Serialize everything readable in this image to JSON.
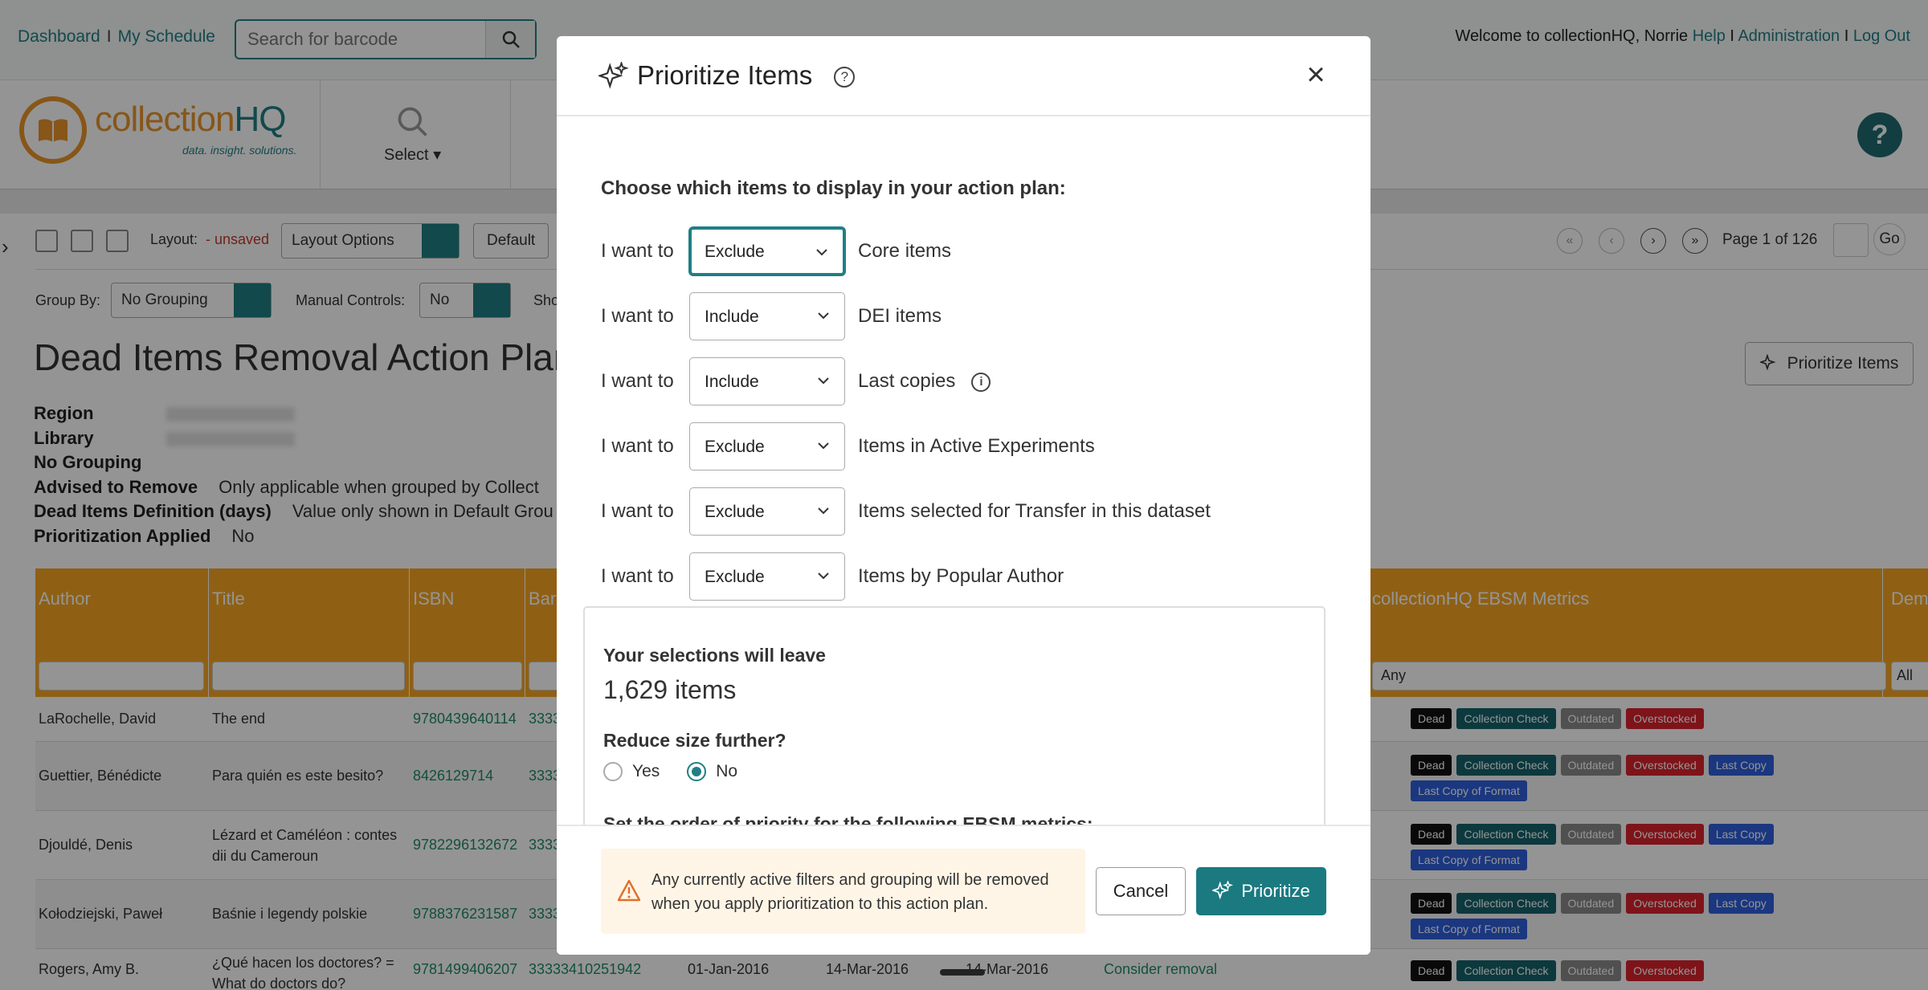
{
  "topnav": {
    "links": [
      "Dashboard",
      "My Schedule"
    ],
    "search_placeholder": "Search for barcode",
    "welcome": "Welcome to collectionHQ, Norrie",
    "right_links": [
      "Help",
      "Administration",
      "Log Out"
    ]
  },
  "brand": {
    "name_part1": "collection",
    "name_part2": "HQ",
    "tagline": "data. insight. solutions.",
    "select_label": "Select"
  },
  "toolbar": {
    "layout_label": "Layout:",
    "layout_state": "- unsaved",
    "layout_options": "Layout Options",
    "default_btn": "Default",
    "group_by_label": "Group By:",
    "group_by_value": "No Grouping",
    "manual_controls_label": "Manual Controls:",
    "manual_controls_value": "No",
    "show_label": "Sho",
    "page_text": "Page 1 of 126",
    "go": "Go"
  },
  "page": {
    "title": "Dead Items Removal Action Plan",
    "meta": [
      {
        "k": "Region",
        "v": ""
      },
      {
        "k": "Library",
        "v": ""
      },
      {
        "k": "No Grouping",
        "v": ""
      },
      {
        "k": "Advised to Remove",
        "v": "Only applicable when grouped by Collect"
      },
      {
        "k": "Dead Items Definition (days)",
        "v": "Value only shown in Default Grou"
      },
      {
        "k": "Prioritization Applied",
        "v": "No"
      }
    ],
    "prioritize_btn": "Prioritize Items"
  },
  "table": {
    "headers": [
      "Author",
      "Title",
      "ISBN",
      "Bar",
      "collectionHQ EBSM Metrics",
      "Dem"
    ],
    "ebsm_filter": "Any",
    "dem_filter": "All",
    "rows": [
      {
        "author": "LaRochelle, David",
        "title": "The end",
        "isbn": "9780439640114",
        "bar": "3333",
        "tags": [
          "Dead",
          "Collection Check",
          "Outdated",
          "Overstocked"
        ]
      },
      {
        "author": "Guettier, Bénédicte",
        "title": "Para quién es este besito?",
        "isbn": "8426129714",
        "bar": "3333",
        "tags": [
          "Dead",
          "Collection Check",
          "Outdated",
          "Overstocked",
          "Last Copy",
          "Last Copy of Format"
        ]
      },
      {
        "author": "Djouldé, Denis",
        "title": "Lézard et Caméléon : contes dii du Cameroun",
        "isbn": "9782296132672",
        "bar": "3333",
        "tags": [
          "Dead",
          "Collection Check",
          "Outdated",
          "Overstocked",
          "Last Copy",
          "Last Copy of Format"
        ]
      },
      {
        "author": "Kołodziejski, Paweł",
        "title": "Baśnie i legendy polskie",
        "isbn": "9788376231587",
        "bar": "3333",
        "tags": [
          "Dead",
          "Collection Check",
          "Outdated",
          "Overstocked",
          "Last Copy",
          "Last Copy of Format"
        ]
      },
      {
        "author": "Rogers, Amy B.",
        "title": "¿Qué hacen los doctores? = What do doctors do?",
        "isbn": "9781499406207",
        "bar": "33333410251942",
        "d1": "01-Jan-2016",
        "d2": "14-Mar-2016",
        "d3": "14-Mar-2016",
        "action": "Consider removal",
        "tags": [
          "Dead",
          "Collection Check",
          "Outdated",
          "Overstocked"
        ]
      }
    ]
  },
  "modal": {
    "title": "Prioritize Items",
    "instruction": "Choose which items to display in your action plan:",
    "i_want_to": "I want to",
    "options": [
      {
        "value": "Exclude",
        "label": "Core items"
      },
      {
        "value": "Include",
        "label": "DEI items"
      },
      {
        "value": "Include",
        "label": "Last copies"
      },
      {
        "value": "Exclude",
        "label": "Items in Active Experiments"
      },
      {
        "value": "Exclude",
        "label": "Items selected for Transfer in this dataset"
      },
      {
        "value": "Exclude",
        "label": "Items by Popular Author"
      }
    ],
    "summary_label": "Your selections will leave",
    "summary_value": "1,629 items",
    "reduce_label": "Reduce size further?",
    "yes": "Yes",
    "no": "No",
    "reduce_selected": "No",
    "order_label": "Set the order of priority for the following EBSM metrics:",
    "warning": "Any currently active filters and grouping will be removed when you apply prioritization to this action plan.",
    "cancel": "Cancel",
    "prioritize": "Prioritize"
  },
  "colors": {
    "accent": "#1f7f84",
    "header_orange": "#f6a623",
    "warning_bg": "#fff5e6"
  }
}
